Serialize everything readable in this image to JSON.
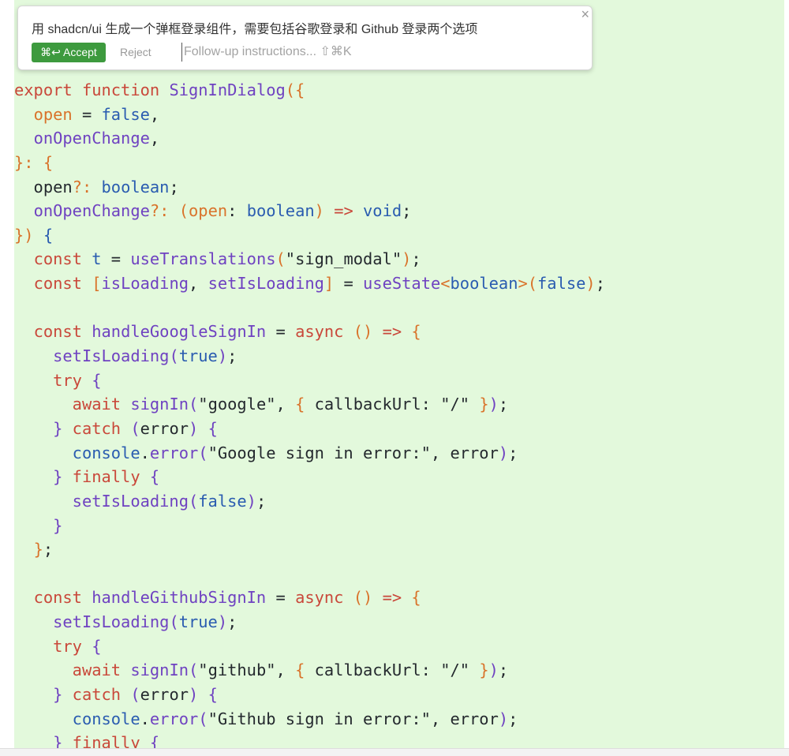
{
  "colors": {
    "editor_bg": "#e3f9dc",
    "keyword": "#c9483a",
    "identifier": "#6f42c1",
    "literal": "#2a5cb0",
    "punct": "#d9732b",
    "accept": "#3d9a3e"
  },
  "popup": {
    "prompt": "用 shadcn/ui 生成一个弹框登录组件，需要包括谷歌登录和 Github 登录两个选项",
    "accept_label": "⌘↩ Accept",
    "reject_label": "Reject",
    "followup_placeholder": "Follow-up instructions... ⇧⌘K",
    "followup_value": "",
    "close_icon": "close-icon"
  },
  "code": [
    [
      [
        "k",
        "export"
      ],
      [
        "p",
        " "
      ],
      [
        "k",
        "function"
      ],
      [
        "p",
        " "
      ],
      [
        "f",
        "SignInDialog"
      ],
      [
        "o",
        "({"
      ]
    ],
    [
      [
        "p",
        "  "
      ],
      [
        "o",
        "open"
      ],
      [
        "p",
        " = "
      ],
      [
        "b",
        "false"
      ],
      [
        "p",
        ","
      ]
    ],
    [
      [
        "p",
        "  "
      ],
      [
        "f",
        "onOpenChange"
      ],
      [
        "p",
        ","
      ]
    ],
    [
      [
        "o",
        "}:"
      ],
      [
        "p",
        " "
      ],
      [
        "o",
        "{"
      ]
    ],
    [
      [
        "p",
        "  open"
      ],
      [
        "o",
        "?:"
      ],
      [
        "p",
        " "
      ],
      [
        "b",
        "boolean"
      ],
      [
        "p",
        ";"
      ]
    ],
    [
      [
        "p",
        "  "
      ],
      [
        "f",
        "onOpenChange"
      ],
      [
        "o",
        "?:"
      ],
      [
        "p",
        " "
      ],
      [
        "o",
        "("
      ],
      [
        "o",
        "open"
      ],
      [
        "p",
        ": "
      ],
      [
        "b",
        "boolean"
      ],
      [
        "o",
        ")"
      ],
      [
        "p",
        " "
      ],
      [
        "k",
        "=>"
      ],
      [
        "p",
        " "
      ],
      [
        "b",
        "void"
      ],
      [
        "p",
        ";"
      ]
    ],
    [
      [
        "o",
        "})"
      ],
      [
        "p",
        " "
      ],
      [
        "b",
        "{"
      ]
    ],
    [
      [
        "p",
        "  "
      ],
      [
        "k",
        "const"
      ],
      [
        "p",
        " "
      ],
      [
        "b",
        "t"
      ],
      [
        "p",
        " = "
      ],
      [
        "f",
        "useTranslations"
      ],
      [
        "o",
        "("
      ],
      [
        "p",
        "\"sign_modal\""
      ],
      [
        "o",
        ")"
      ],
      [
        "p",
        ";"
      ]
    ],
    [
      [
        "p",
        "  "
      ],
      [
        "k",
        "const"
      ],
      [
        "p",
        " "
      ],
      [
        "o",
        "["
      ],
      [
        "f",
        "isLoading"
      ],
      [
        "p",
        ", "
      ],
      [
        "f",
        "setIsLoading"
      ],
      [
        "o",
        "]"
      ],
      [
        "p",
        " = "
      ],
      [
        "f",
        "useState"
      ],
      [
        "o",
        "<"
      ],
      [
        "b",
        "boolean"
      ],
      [
        "o",
        ">("
      ],
      [
        "b",
        "false"
      ],
      [
        "o",
        ")"
      ],
      [
        "p",
        ";"
      ]
    ],
    [],
    [
      [
        "p",
        "  "
      ],
      [
        "k",
        "const"
      ],
      [
        "p",
        " "
      ],
      [
        "f",
        "handleGoogleSignIn"
      ],
      [
        "p",
        " = "
      ],
      [
        "k",
        "async"
      ],
      [
        "p",
        " "
      ],
      [
        "o",
        "()"
      ],
      [
        "p",
        " "
      ],
      [
        "k",
        "=>"
      ],
      [
        "p",
        " "
      ],
      [
        "o",
        "{"
      ]
    ],
    [
      [
        "p",
        "    "
      ],
      [
        "f",
        "setIsLoading"
      ],
      [
        "f",
        "("
      ],
      [
        "b",
        "true"
      ],
      [
        "f",
        ")"
      ],
      [
        "p",
        ";"
      ]
    ],
    [
      [
        "p",
        "    "
      ],
      [
        "k",
        "try"
      ],
      [
        "p",
        " "
      ],
      [
        "f",
        "{"
      ]
    ],
    [
      [
        "p",
        "      "
      ],
      [
        "k",
        "await"
      ],
      [
        "p",
        " "
      ],
      [
        "f",
        "signIn"
      ],
      [
        "f",
        "("
      ],
      [
        "p",
        "\"google\", "
      ],
      [
        "o",
        "{"
      ],
      [
        "p",
        " callbackUrl: \"/\" "
      ],
      [
        "o",
        "}"
      ],
      [
        "f",
        ")"
      ],
      [
        "p",
        ";"
      ]
    ],
    [
      [
        "p",
        "    "
      ],
      [
        "f",
        "}"
      ],
      [
        "p",
        " "
      ],
      [
        "k",
        "catch"
      ],
      [
        "p",
        " "
      ],
      [
        "f",
        "("
      ],
      [
        "p",
        "error"
      ],
      [
        "f",
        ")"
      ],
      [
        "p",
        " "
      ],
      [
        "f",
        "{"
      ]
    ],
    [
      [
        "p",
        "      "
      ],
      [
        "b",
        "console"
      ],
      [
        "p",
        "."
      ],
      [
        "f",
        "error"
      ],
      [
        "f",
        "("
      ],
      [
        "p",
        "\"Google sign in error:\", error"
      ],
      [
        "f",
        ")"
      ],
      [
        "p",
        ";"
      ]
    ],
    [
      [
        "p",
        "    "
      ],
      [
        "f",
        "}"
      ],
      [
        "p",
        " "
      ],
      [
        "k",
        "finally"
      ],
      [
        "p",
        " "
      ],
      [
        "f",
        "{"
      ]
    ],
    [
      [
        "p",
        "      "
      ],
      [
        "f",
        "setIsLoading"
      ],
      [
        "f",
        "("
      ],
      [
        "b",
        "false"
      ],
      [
        "f",
        ")"
      ],
      [
        "p",
        ";"
      ]
    ],
    [
      [
        "p",
        "    "
      ],
      [
        "f",
        "}"
      ]
    ],
    [
      [
        "p",
        "  "
      ],
      [
        "o",
        "}"
      ],
      [
        "p",
        ";"
      ]
    ],
    [],
    [
      [
        "p",
        "  "
      ],
      [
        "k",
        "const"
      ],
      [
        "p",
        " "
      ],
      [
        "f",
        "handleGithubSignIn"
      ],
      [
        "p",
        " = "
      ],
      [
        "k",
        "async"
      ],
      [
        "p",
        " "
      ],
      [
        "o",
        "()"
      ],
      [
        "p",
        " "
      ],
      [
        "k",
        "=>"
      ],
      [
        "p",
        " "
      ],
      [
        "o",
        "{"
      ]
    ],
    [
      [
        "p",
        "    "
      ],
      [
        "f",
        "setIsLoading"
      ],
      [
        "f",
        "("
      ],
      [
        "b",
        "true"
      ],
      [
        "f",
        ")"
      ],
      [
        "p",
        ";"
      ]
    ],
    [
      [
        "p",
        "    "
      ],
      [
        "k",
        "try"
      ],
      [
        "p",
        " "
      ],
      [
        "f",
        "{"
      ]
    ],
    [
      [
        "p",
        "      "
      ],
      [
        "k",
        "await"
      ],
      [
        "p",
        " "
      ],
      [
        "f",
        "signIn"
      ],
      [
        "f",
        "("
      ],
      [
        "p",
        "\"github\", "
      ],
      [
        "o",
        "{"
      ],
      [
        "p",
        " callbackUrl: \"/\" "
      ],
      [
        "o",
        "}"
      ],
      [
        "f",
        ")"
      ],
      [
        "p",
        ";"
      ]
    ],
    [
      [
        "p",
        "    "
      ],
      [
        "f",
        "}"
      ],
      [
        "p",
        " "
      ],
      [
        "k",
        "catch"
      ],
      [
        "p",
        " "
      ],
      [
        "f",
        "("
      ],
      [
        "p",
        "error"
      ],
      [
        "f",
        ")"
      ],
      [
        "p",
        " "
      ],
      [
        "f",
        "{"
      ]
    ],
    [
      [
        "p",
        "      "
      ],
      [
        "b",
        "console"
      ],
      [
        "p",
        "."
      ],
      [
        "f",
        "error"
      ],
      [
        "f",
        "("
      ],
      [
        "p",
        "\"Github sign in error:\", error"
      ],
      [
        "f",
        ")"
      ],
      [
        "p",
        ";"
      ]
    ],
    [
      [
        "p",
        "    "
      ],
      [
        "f",
        "}"
      ],
      [
        "p",
        " "
      ],
      [
        "k",
        "finally"
      ],
      [
        "p",
        " "
      ],
      [
        "f",
        "{"
      ]
    ]
  ]
}
